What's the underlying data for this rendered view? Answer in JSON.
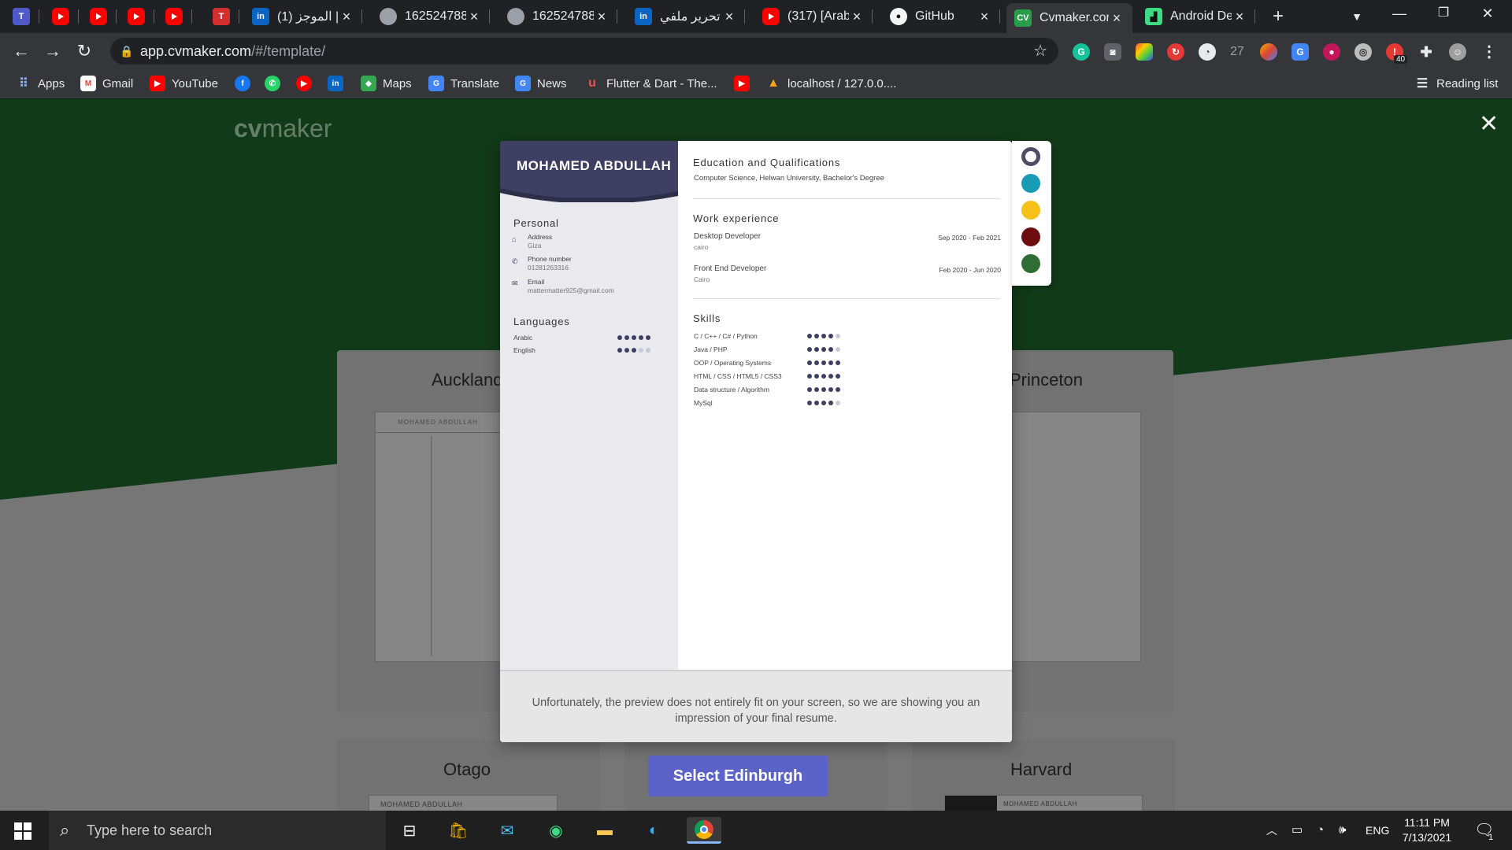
{
  "browser": {
    "tabs": [
      {
        "title": "",
        "favicon": "teams-icon"
      },
      {
        "title": "",
        "favicon": "youtube-icon"
      },
      {
        "title": "",
        "favicon": "youtube-icon"
      },
      {
        "title": "",
        "favicon": "youtube-icon"
      },
      {
        "title": "",
        "favicon": "youtube-icon"
      },
      {
        "title": "",
        "favicon": "tn-icon"
      },
      {
        "title": "(1) الموجز | ...",
        "favicon": "linkedin-icon"
      },
      {
        "title": "1625247884",
        "favicon": "globe-icon"
      },
      {
        "title": "1625247884",
        "favicon": "globe-icon"
      },
      {
        "title": "تحرير ملفي | ...",
        "favicon": "linkedin-icon"
      },
      {
        "title": "(317) [Arabic...",
        "favicon": "youtube-icon"
      },
      {
        "title": "GitHub",
        "favicon": "github-icon"
      },
      {
        "title": "Cvmaker.com",
        "favicon": "cvmaker-icon"
      },
      {
        "title": "Android Dev...",
        "favicon": "android-icon"
      }
    ],
    "new_tab": "+",
    "url_host": "app.cvmaker.com",
    "url_path": "/#/template/",
    "extension_badge_count": "27",
    "extension_badge_40": "40",
    "bookmarks": [
      {
        "label": "Apps",
        "icon": "apps-grid-icon"
      },
      {
        "label": "Gmail",
        "icon": "gmail-icon"
      },
      {
        "label": "YouTube",
        "icon": "youtube-icon"
      },
      {
        "label": "",
        "icon": "facebook-icon"
      },
      {
        "label": "",
        "icon": "whatsapp-icon"
      },
      {
        "label": "",
        "icon": "youtube-music-icon"
      },
      {
        "label": "",
        "icon": "linkedin-icon"
      },
      {
        "label": "Maps",
        "icon": "maps-icon"
      },
      {
        "label": "Translate",
        "icon": "translate-icon"
      },
      {
        "label": "News",
        "icon": "news-icon"
      },
      {
        "label": "Flutter & Dart - The...",
        "icon": "udemy-icon"
      },
      {
        "label": "",
        "icon": "youtube-icon"
      },
      {
        "label": "localhost / 127.0.0....",
        "icon": "phpmyadmin-icon"
      }
    ],
    "reading_list": "Reading list"
  },
  "page": {
    "logo_prefix": "cv",
    "logo_suffix": "maker",
    "gallery": [
      "Auckland",
      "Princeton",
      "Otago",
      "Harvard"
    ],
    "select_button": "Select Edinburgh"
  },
  "resume": {
    "name": "MOHAMED ABDULLAH",
    "personal_title": "Personal",
    "address_label": "Address",
    "address_value": "Giza",
    "phone_label": "Phone number",
    "phone_value": "01281263316",
    "email_label": "Email",
    "email_value": "mattermatter925@gmail.com",
    "languages_title": "Languages",
    "languages": [
      {
        "name": "Arabic",
        "level": 5
      },
      {
        "name": "English",
        "level": 3
      }
    ],
    "education_title": "Education and Qualifications",
    "education_line": "Computer Science, Helwan University, Bachelor's Degree",
    "work_title": "Work experience",
    "jobs": [
      {
        "title": "Desktop Developer",
        "place": "cairo",
        "dates": "Sep 2020 - Feb 2021"
      },
      {
        "title": "Front End Developer",
        "place": "Cairo",
        "dates": "Feb 2020 - Jun 2020"
      }
    ],
    "skills_title": "Skills",
    "skills": [
      {
        "name": "C / C++ / C# / Python",
        "level": 4
      },
      {
        "name": "Java / PHP",
        "level": 4
      },
      {
        "name": "OOP / Operating Systems",
        "level": 5
      },
      {
        "name": "HTML / CSS / HTML5 / CSS3",
        "level": 5
      },
      {
        "name": "Data structure / Algorithm",
        "level": 5
      },
      {
        "name": "MySql",
        "level": 4
      }
    ],
    "footer_note": "Unfortunately, the preview does not entirely fit on your screen, so we are showing you an impression of your final resume."
  },
  "palette": {
    "colors": [
      "#4b4e66",
      "#1a9bb5",
      "#f5c018",
      "#6e0d0d",
      "#2e6e34"
    ],
    "selected_index": 0
  },
  "taskbar": {
    "search_placeholder": "Type here to search",
    "language": "ENG",
    "time": "11:11 PM",
    "date": "7/13/2021",
    "notification_count": "1"
  },
  "colors": {
    "cv_accent": "#3e3f63",
    "select_button": "#5b63c9",
    "header_green": "#1f6b2f"
  }
}
